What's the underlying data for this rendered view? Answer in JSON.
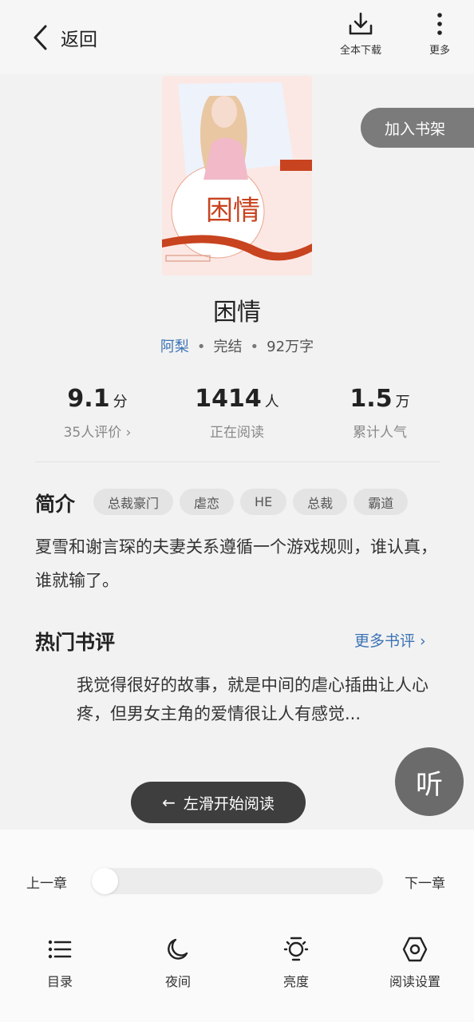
{
  "header": {
    "back_label": "返回",
    "download_label": "全本下载",
    "more_label": "更多"
  },
  "book": {
    "title": "困情",
    "author": "阿梨",
    "status": "完结",
    "word_count": "92万字",
    "add_to_shelf_label": "加入书架"
  },
  "stats": [
    {
      "value": "9.1",
      "unit": "分",
      "sub": "35人评价 ›"
    },
    {
      "value": "1414",
      "unit": "人",
      "sub": "正在阅读"
    },
    {
      "value": "1.5",
      "unit": "万",
      "sub": "累计人气"
    }
  ],
  "intro": {
    "heading": "简介",
    "tags": [
      "总裁豪门",
      "虐恋",
      "HE",
      "总裁",
      "霸道"
    ],
    "text": "夏雪和谢言琛的夫妻关系遵循一个游戏规则，谁认真，谁就输了。"
  },
  "reviews": {
    "heading": "热门书评",
    "more_label": "更多书评 ›",
    "text": "我觉得很好的故事，就是中间的虐心插曲让人心疼，但男女主角的爱情很让人有感觉..."
  },
  "listen_label": "听",
  "swipe_label": "左滑开始阅读",
  "progress": {
    "prev_label": "上一章",
    "next_label": "下一章",
    "value": 0
  },
  "bottom_nav": [
    {
      "label": "目录",
      "icon": "list-icon"
    },
    {
      "label": "夜间",
      "icon": "moon-icon"
    },
    {
      "label": "亮度",
      "icon": "lightbulb-icon"
    },
    {
      "label": "阅读设置",
      "icon": "settings-hexagon-icon"
    }
  ],
  "colors": {
    "accent_blue": "#3c73b5",
    "dark_button": "#3e3e3e",
    "cover_red": "#c8431f"
  }
}
